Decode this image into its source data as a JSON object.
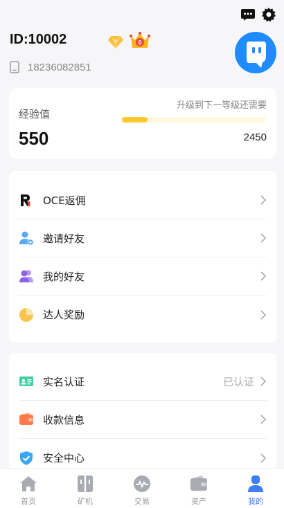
{
  "header": {
    "user_id": "ID:10002",
    "vip_level": "V",
    "crown_count": "0",
    "phone": "18236082851",
    "icons": [
      "message-icon",
      "gear-icon",
      "vip-diamond-icon",
      "crown-icon",
      "phone-icon",
      "avatar"
    ]
  },
  "experience": {
    "label": "经验值",
    "value": "550",
    "upgrade_hint": "升级到下一等级还需要",
    "target": "2450",
    "progress_fraction": 0.18,
    "bar_color": "#ffc82e"
  },
  "menu_group1": [
    {
      "label": "OCE返佣",
      "icon": "oce-logo-icon"
    },
    {
      "label": "邀请好友",
      "icon": "invite-user-icon"
    },
    {
      "label": "我的好友",
      "icon": "friends-icon"
    },
    {
      "label": "达人奖励",
      "icon": "pie-chart-icon"
    }
  ],
  "menu_group2": [
    {
      "label": "实名认证",
      "icon": "id-card-icon",
      "status": "已认证"
    },
    {
      "label": "收款信息",
      "icon": "wallet-icon",
      "status": ""
    },
    {
      "label": "安全中心",
      "icon": "shield-icon",
      "status": ""
    }
  ],
  "tabs": [
    {
      "label": "首页",
      "icon": "home-icon",
      "active": false
    },
    {
      "label": "矿机",
      "icon": "miner-icon",
      "active": false
    },
    {
      "label": "交易",
      "icon": "trade-icon",
      "active": false
    },
    {
      "label": "资产",
      "icon": "assets-wallet-icon",
      "active": false
    },
    {
      "label": "我的",
      "icon": "profile-icon",
      "active": true
    }
  ],
  "colors": {
    "accent": "#3d7ef2",
    "avatar_bg": "#1e8cff",
    "tab_inactive": "#999999"
  }
}
